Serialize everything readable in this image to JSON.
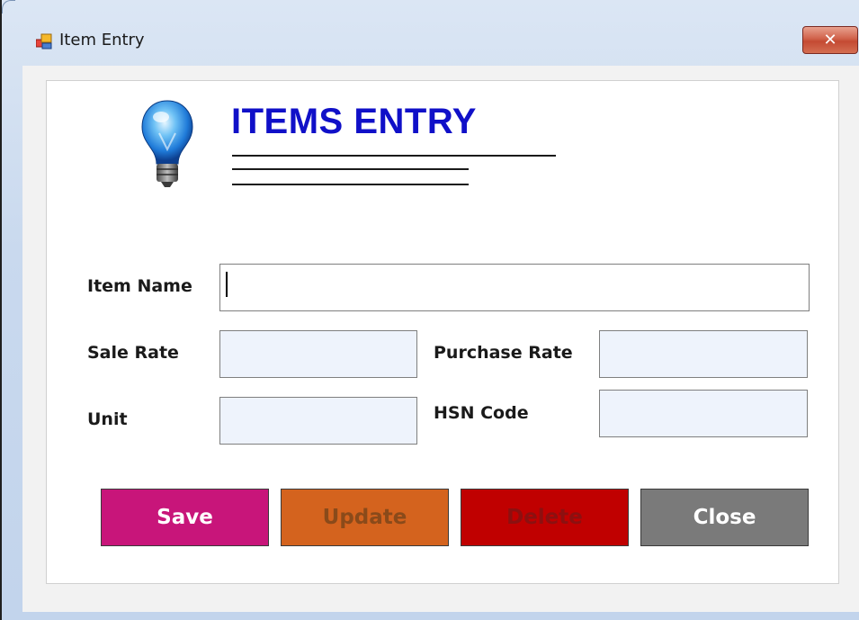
{
  "window": {
    "title": "Item Entry",
    "close_label": "✕",
    "app_icon": "form-window-icon"
  },
  "header": {
    "title": "ITEMS ENTRY",
    "icon": "lightbulb-icon"
  },
  "form": {
    "item_name": {
      "label": "Item Name",
      "value": ""
    },
    "sale_rate": {
      "label": "Sale Rate",
      "value": ""
    },
    "purchase_rate": {
      "label": "Purchase Rate",
      "value": ""
    },
    "unit": {
      "label": "Unit",
      "value": ""
    },
    "hsn_code": {
      "label": "HSN Code",
      "value": ""
    }
  },
  "buttons": {
    "save": {
      "label": "Save",
      "bg": "#c8157a",
      "fg": "#ffffff"
    },
    "update": {
      "label": "Update",
      "bg": "#d4631e",
      "fg": "#8a4a1a"
    },
    "delete": {
      "label": "Delete",
      "bg": "#c00000",
      "fg": "#8c1010"
    },
    "close": {
      "label": "Close",
      "bg": "#7a7a7a",
      "fg": "#ffffff"
    }
  },
  "colors": {
    "title_blue": "#1010c8",
    "field_bg": "#eef3fc"
  }
}
